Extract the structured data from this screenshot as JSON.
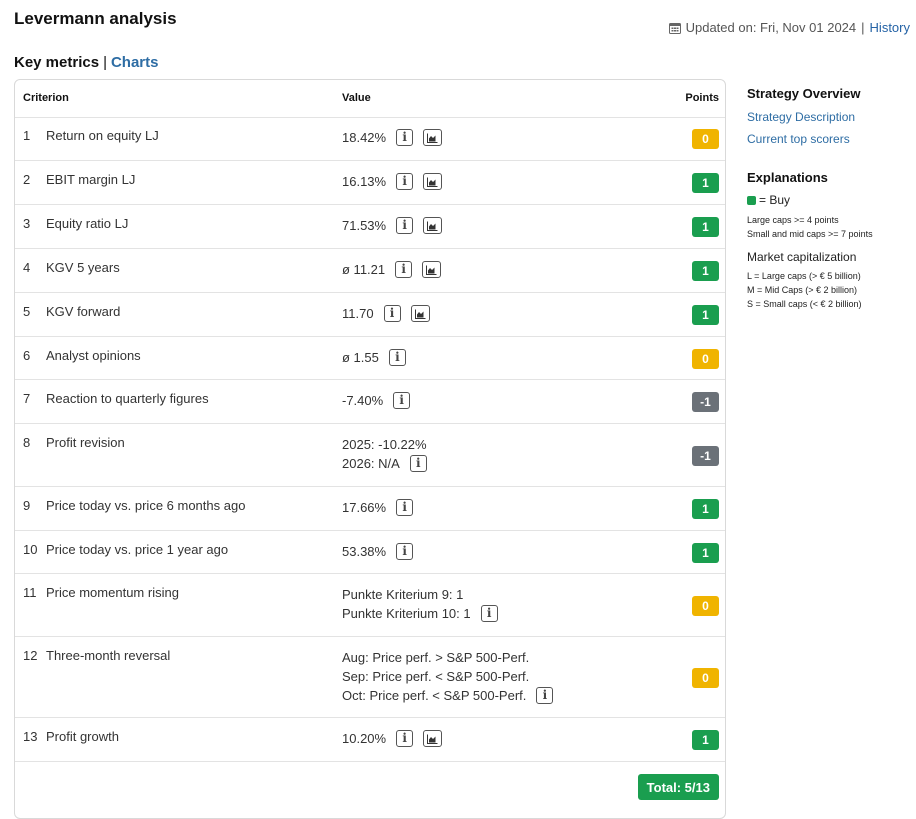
{
  "page": {
    "title": "Levermann analysis",
    "updated": "Updated on: Fri, Nov 01 2024",
    "history": "History",
    "calendar_icon": "calendar-icon"
  },
  "subnav": {
    "key_metrics": "Key metrics",
    "separator": "|",
    "charts": "Charts"
  },
  "table": {
    "headers": {
      "criterion": "Criterion",
      "value": "Value",
      "points": "Points"
    },
    "rows": [
      {
        "num": "1",
        "criterion": "Return on equity LJ",
        "values": [
          "18.42%"
        ],
        "info": true,
        "chart": true,
        "points": "0",
        "status": "neutral"
      },
      {
        "num": "2",
        "criterion": "EBIT margin LJ",
        "values": [
          "16.13%"
        ],
        "info": true,
        "chart": true,
        "points": "1",
        "status": "buy"
      },
      {
        "num": "3",
        "criterion": "Equity ratio LJ",
        "values": [
          "71.53%"
        ],
        "info": true,
        "chart": true,
        "points": "1",
        "status": "buy"
      },
      {
        "num": "4",
        "criterion": "KGV 5 years",
        "values": [
          "ø 11.21"
        ],
        "info": true,
        "chart": true,
        "points": "1",
        "status": "buy"
      },
      {
        "num": "5",
        "criterion": "KGV forward",
        "values": [
          "11.70"
        ],
        "info": true,
        "chart": true,
        "points": "1",
        "status": "buy"
      },
      {
        "num": "6",
        "criterion": "Analyst opinions",
        "values": [
          "ø 1.55"
        ],
        "info": true,
        "chart": false,
        "points": "0",
        "status": "neutral"
      },
      {
        "num": "7",
        "criterion": "Reaction to quarterly figures",
        "values": [
          "-7.40%"
        ],
        "info": true,
        "chart": false,
        "points": "-1",
        "status": "negative"
      },
      {
        "num": "8",
        "criterion": "Profit revision",
        "values": [
          "2025: -10.22%",
          "2026: N/A"
        ],
        "info": true,
        "chart": false,
        "points": "-1",
        "status": "negative"
      },
      {
        "num": "9",
        "criterion": "Price today vs. price 6 months ago",
        "values": [
          "17.66%"
        ],
        "info": true,
        "chart": false,
        "points": "1",
        "status": "buy"
      },
      {
        "num": "10",
        "criterion": "Price today vs. price 1 year ago",
        "values": [
          "53.38%"
        ],
        "info": true,
        "chart": false,
        "points": "1",
        "status": "buy"
      },
      {
        "num": "11",
        "criterion": "Price momentum rising",
        "values": [
          "Punkte Kriterium 9: 1",
          "Punkte Kriterium 10: 1"
        ],
        "info": true,
        "chart": false,
        "points": "0",
        "status": "neutral"
      },
      {
        "num": "12",
        "criterion": "Three-month reversal",
        "values": [
          "Aug: Price perf. > S&P 500-Perf.",
          "Sep: Price perf. < S&P 500-Perf.",
          "Oct: Price perf. < S&P 500-Perf."
        ],
        "info": true,
        "chart": false,
        "points": "0",
        "status": "neutral"
      },
      {
        "num": "13",
        "criterion": "Profit growth",
        "values": [
          "10.20%"
        ],
        "info": true,
        "chart": true,
        "points": "1",
        "status": "buy"
      }
    ],
    "total": "Total: 5/13"
  },
  "info_icon_glyph": "i",
  "sidebar": {
    "overview_title": "Strategy Overview",
    "links": [
      "Strategy Description",
      "Current top scorers"
    ],
    "explanations_title": "Explanations",
    "buy_legend": "= Buy",
    "rule_large": "Large caps >= 4 points",
    "rule_small": "Small and mid caps >= 7 points",
    "market_cap_title": "Market capitalization",
    "cap_l": "L = Large caps (> € 5 billion)",
    "cap_m": "M = Mid Caps (> € 2 billion)",
    "cap_s": "S = Small caps (< € 2 billion)"
  },
  "colors": {
    "buy": "#1a9e4f",
    "neutral": "#f0b400",
    "negative": "#6b7178",
    "link": "#2e6da4"
  }
}
